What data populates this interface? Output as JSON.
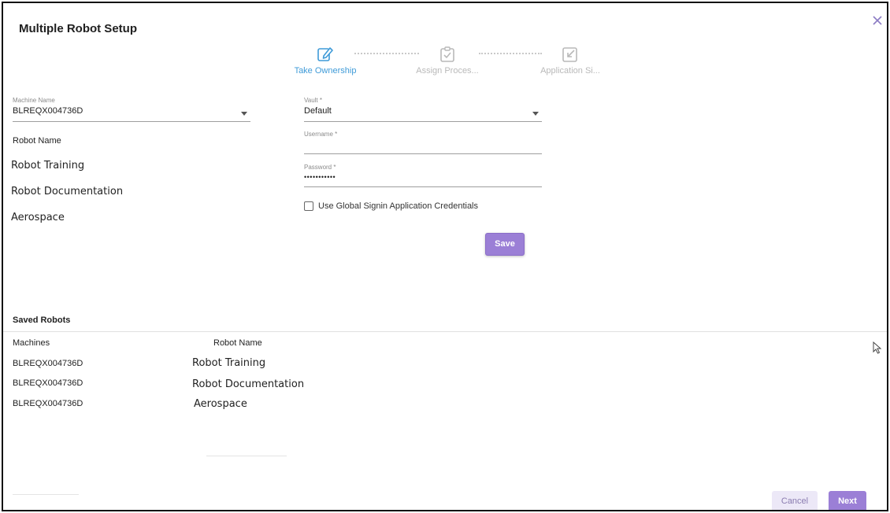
{
  "dialog": {
    "title": "Multiple Robot Setup"
  },
  "stepper": {
    "steps": [
      {
        "label": "Take Ownership",
        "icon": "edit-icon",
        "state": "active"
      },
      {
        "label": "Assign Proces...",
        "icon": "clipboard-check-icon",
        "state": "inactive"
      },
      {
        "label": "Application Si...",
        "icon": "sign-icon",
        "state": "inactive"
      }
    ]
  },
  "form": {
    "machine": {
      "label": "Machine Name",
      "value": "BLREQX004736D"
    },
    "robot_name_label": "Robot Name",
    "robots": [
      "Robot Training",
      "Robot Documentation",
      "Aerospace"
    ],
    "vault": {
      "label": "Vault *",
      "value": "Default"
    },
    "username": {
      "label": "Username *",
      "value": ""
    },
    "password": {
      "label": "Password *",
      "value": "•••••••••••"
    },
    "global_signin": {
      "label": "Use Global Signin Application Credentials",
      "checked": false
    },
    "save_label": "Save"
  },
  "saved_robots": {
    "title": "Saved Robots",
    "columns": [
      "Machines",
      "Robot Name"
    ],
    "rows": [
      {
        "machine": "BLREQX004736D",
        "robot": "Robot Training"
      },
      {
        "machine": "BLREQX004736D",
        "robot": "Robot Documentation"
      },
      {
        "machine": "BLREQX004736D",
        "robot": "Aerospace"
      }
    ]
  },
  "footer": {
    "cancel_label": "Cancel",
    "next_label": "Next"
  },
  "colors": {
    "accent": "#9b7fd6",
    "active_step": "#3f9bd8",
    "inactive": "#b9b9b9"
  }
}
